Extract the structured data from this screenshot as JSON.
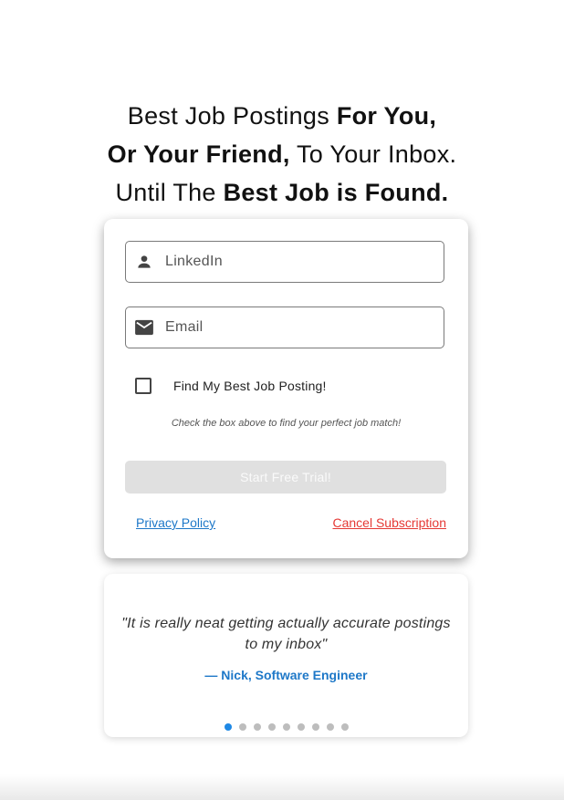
{
  "headline": {
    "line1_regular": "Best Job Postings ",
    "line1_bold": "For You,",
    "line2_bold": "Or Your Friend,",
    "line2_regular": " To Your Inbox.",
    "line3_regular": "Until The ",
    "line3_bold": "Best Job is Found."
  },
  "form": {
    "linkedin_placeholder": "LinkedIn",
    "linkedin_icon": "person-icon",
    "email_placeholder": "Email",
    "email_icon": "mail-icon",
    "checkbox_label": "Find My Best Job Posting!",
    "checkbox_checked": false,
    "hint": "Check the box above to find your perfect job match!",
    "start_button": "Start Free Trial!",
    "privacy_link": "Privacy Policy",
    "cancel_link": "Cancel Subscription"
  },
  "testimonial": {
    "quote": "\"It is really neat getting actually accurate postings to my inbox\"",
    "author": "— Nick, Software Engineer",
    "dot_count": 9,
    "active_dot": 0
  },
  "colors": {
    "accent_blue": "#1e78c8",
    "cancel_red": "#e53935",
    "disabled_button": "#e0e0e0",
    "active_dot": "#1e88e5",
    "inactive_dot": "#bdbdbd"
  }
}
